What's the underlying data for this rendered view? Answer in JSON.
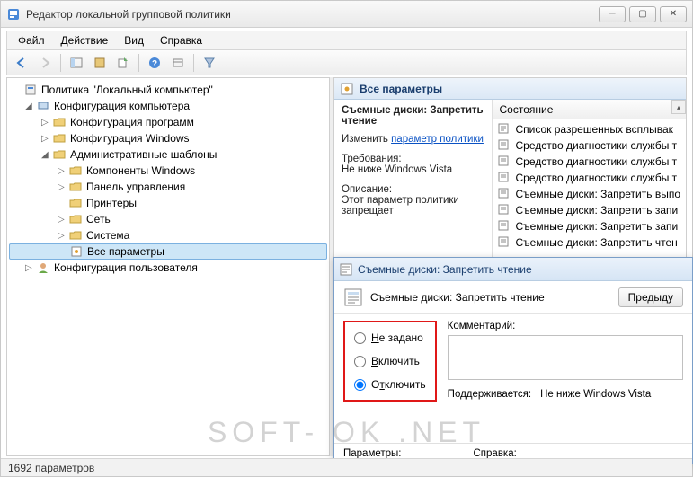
{
  "window": {
    "title": "Редактор локальной групповой политики"
  },
  "menu": {
    "file": "Файл",
    "action": "Действие",
    "view": "Вид",
    "help": "Справка"
  },
  "tree": {
    "root": "Политика \"Локальный компьютер\"",
    "comp_config": "Конфигурация компьютера",
    "prog_config": "Конфигурация программ",
    "win_config": "Конфигурация Windows",
    "admin_templates": "Административные шаблоны",
    "win_components": "Компоненты Windows",
    "control_panel": "Панель управления",
    "printers": "Принтеры",
    "network": "Сеть",
    "system": "Система",
    "all_settings": "Все параметры",
    "user_config": "Конфигурация пользователя"
  },
  "right": {
    "header": "Все параметры",
    "setting_title": "Съемные диски: Запретить чтение",
    "edit_label": "Изменить",
    "edit_link": "параметр политики",
    "req_label": "Требования:",
    "req_value": "Не ниже Windows Vista",
    "desc_label": "Описание:",
    "desc_value": "Этот параметр политики запрещает",
    "col_state": "Состояние",
    "items": [
      "Список разрешенных всплывак",
      "Средство диагностики службы т",
      "Средство диагностики службы т",
      "Средство диагностики службы т",
      "Съемные диски: Запретить выпо",
      "Съемные диски: Запретить запи",
      "Съемные диски: Запретить запи",
      "Съемные диски: Запретить чтен"
    ]
  },
  "dialog": {
    "title": "Съемные диски: Запретить чтение",
    "subtitle": "Съемные диски: Запретить чтение",
    "prev_btn": "Предыду",
    "opt_notset": "Не задано",
    "opt_enable": "Включить",
    "opt_disable": "Отключить",
    "comment_label": "Комментарий:",
    "supported_label": "Поддерживается:",
    "supported_value": "Не ниже Windows Vista",
    "params_label": "Параметры:",
    "help_label": "Справка:"
  },
  "status": {
    "text": "1692 параметров"
  },
  "watermark": "SOFT- OK .NET"
}
